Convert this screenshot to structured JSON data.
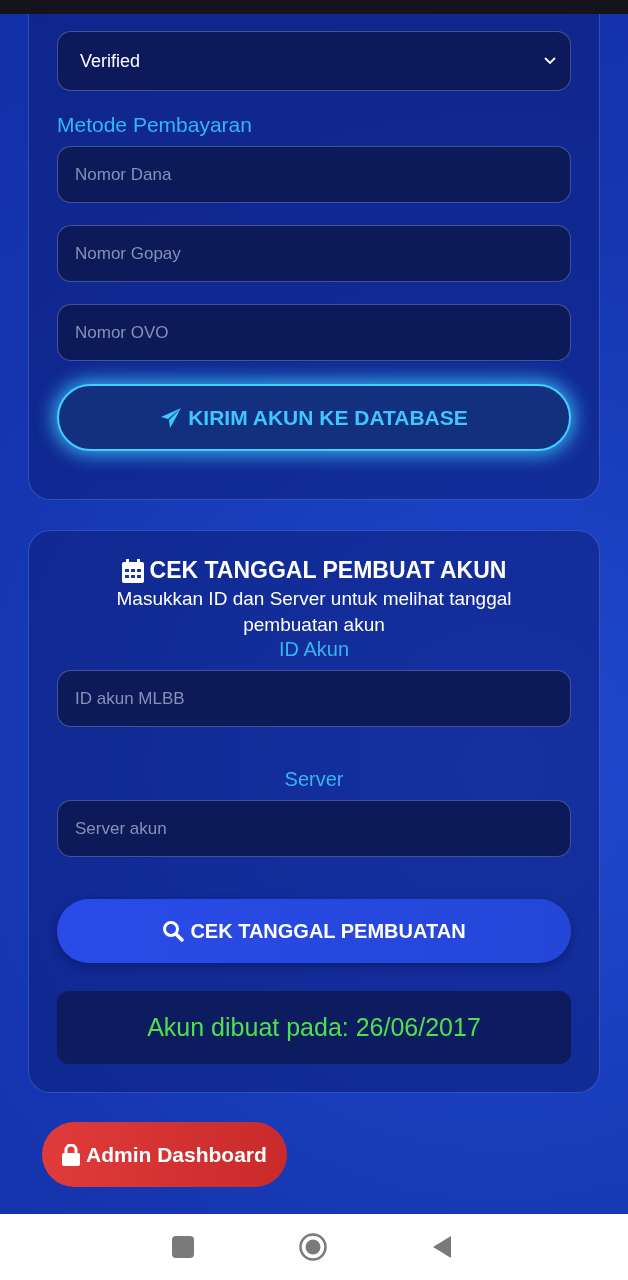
{
  "status_select": {
    "value": "Verified"
  },
  "payment": {
    "label": "Metode Pembayaran",
    "fields": [
      {
        "placeholder": "Nomor Dana"
      },
      {
        "placeholder": "Nomor Gopay"
      },
      {
        "placeholder": "Nomor OVO"
      }
    ]
  },
  "submit_button": {
    "label": "KIRIM AKUN KE DATABASE"
  },
  "check_card": {
    "title": "CEK TANGGAL PEMBUAT AKUN",
    "description": "Masukkan ID dan Server untuk melihat tanggal pembuatan akun",
    "id_label": "ID Akun",
    "id_field": {
      "placeholder": "ID akun MLBB"
    },
    "server_label": "Server",
    "server_field": {
      "placeholder": "Server akun"
    },
    "check_button": {
      "label": "CEK TANGGAL PEMBUATAN"
    },
    "result": "Akun dibuat pada: 26/06/2017"
  },
  "admin_button": {
    "label": "Admin Dashboard"
  }
}
